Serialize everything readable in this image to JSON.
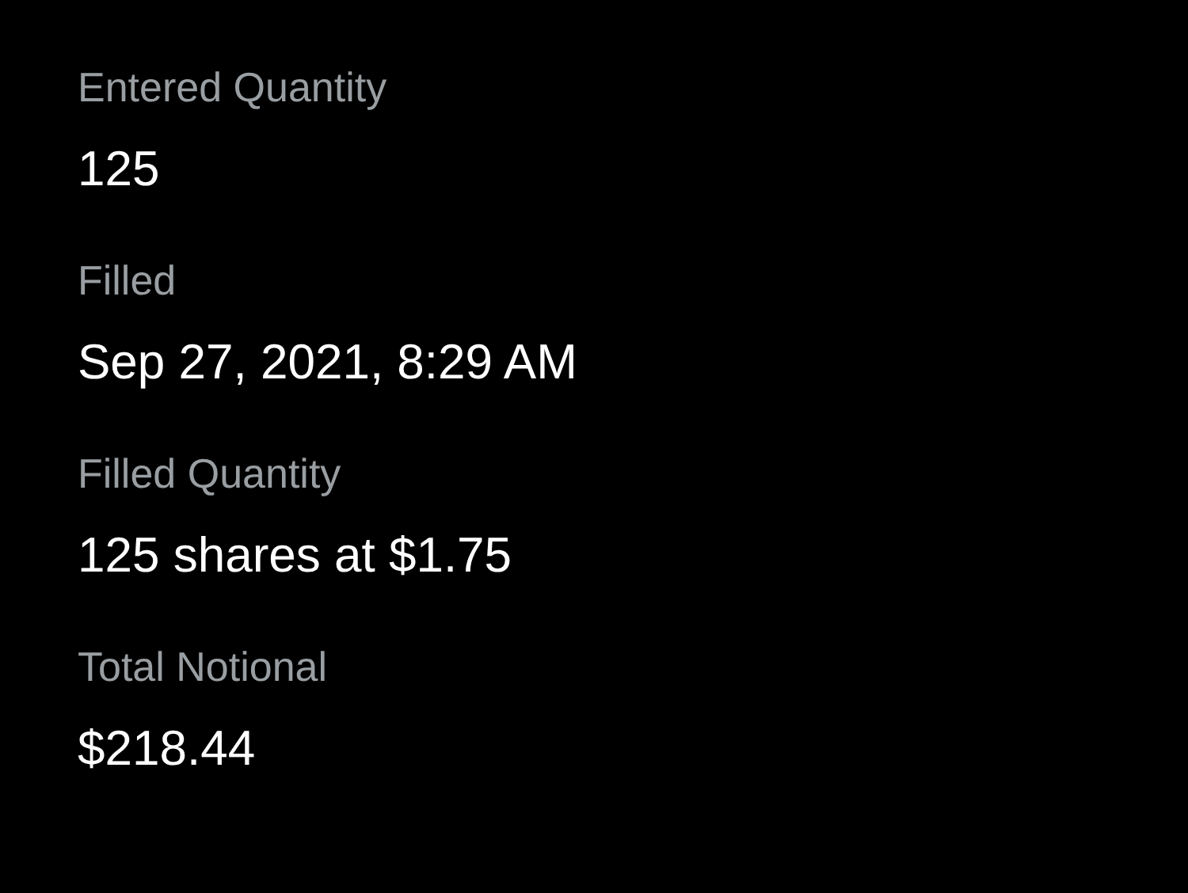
{
  "details": [
    {
      "label": "Entered Quantity",
      "value": "125"
    },
    {
      "label": "Filled",
      "value": "Sep 27, 2021, 8:29 AM"
    },
    {
      "label": "Filled Quantity",
      "value": "125 shares at $1.75"
    },
    {
      "label": "Total Notional",
      "value": "$218.44"
    }
  ]
}
